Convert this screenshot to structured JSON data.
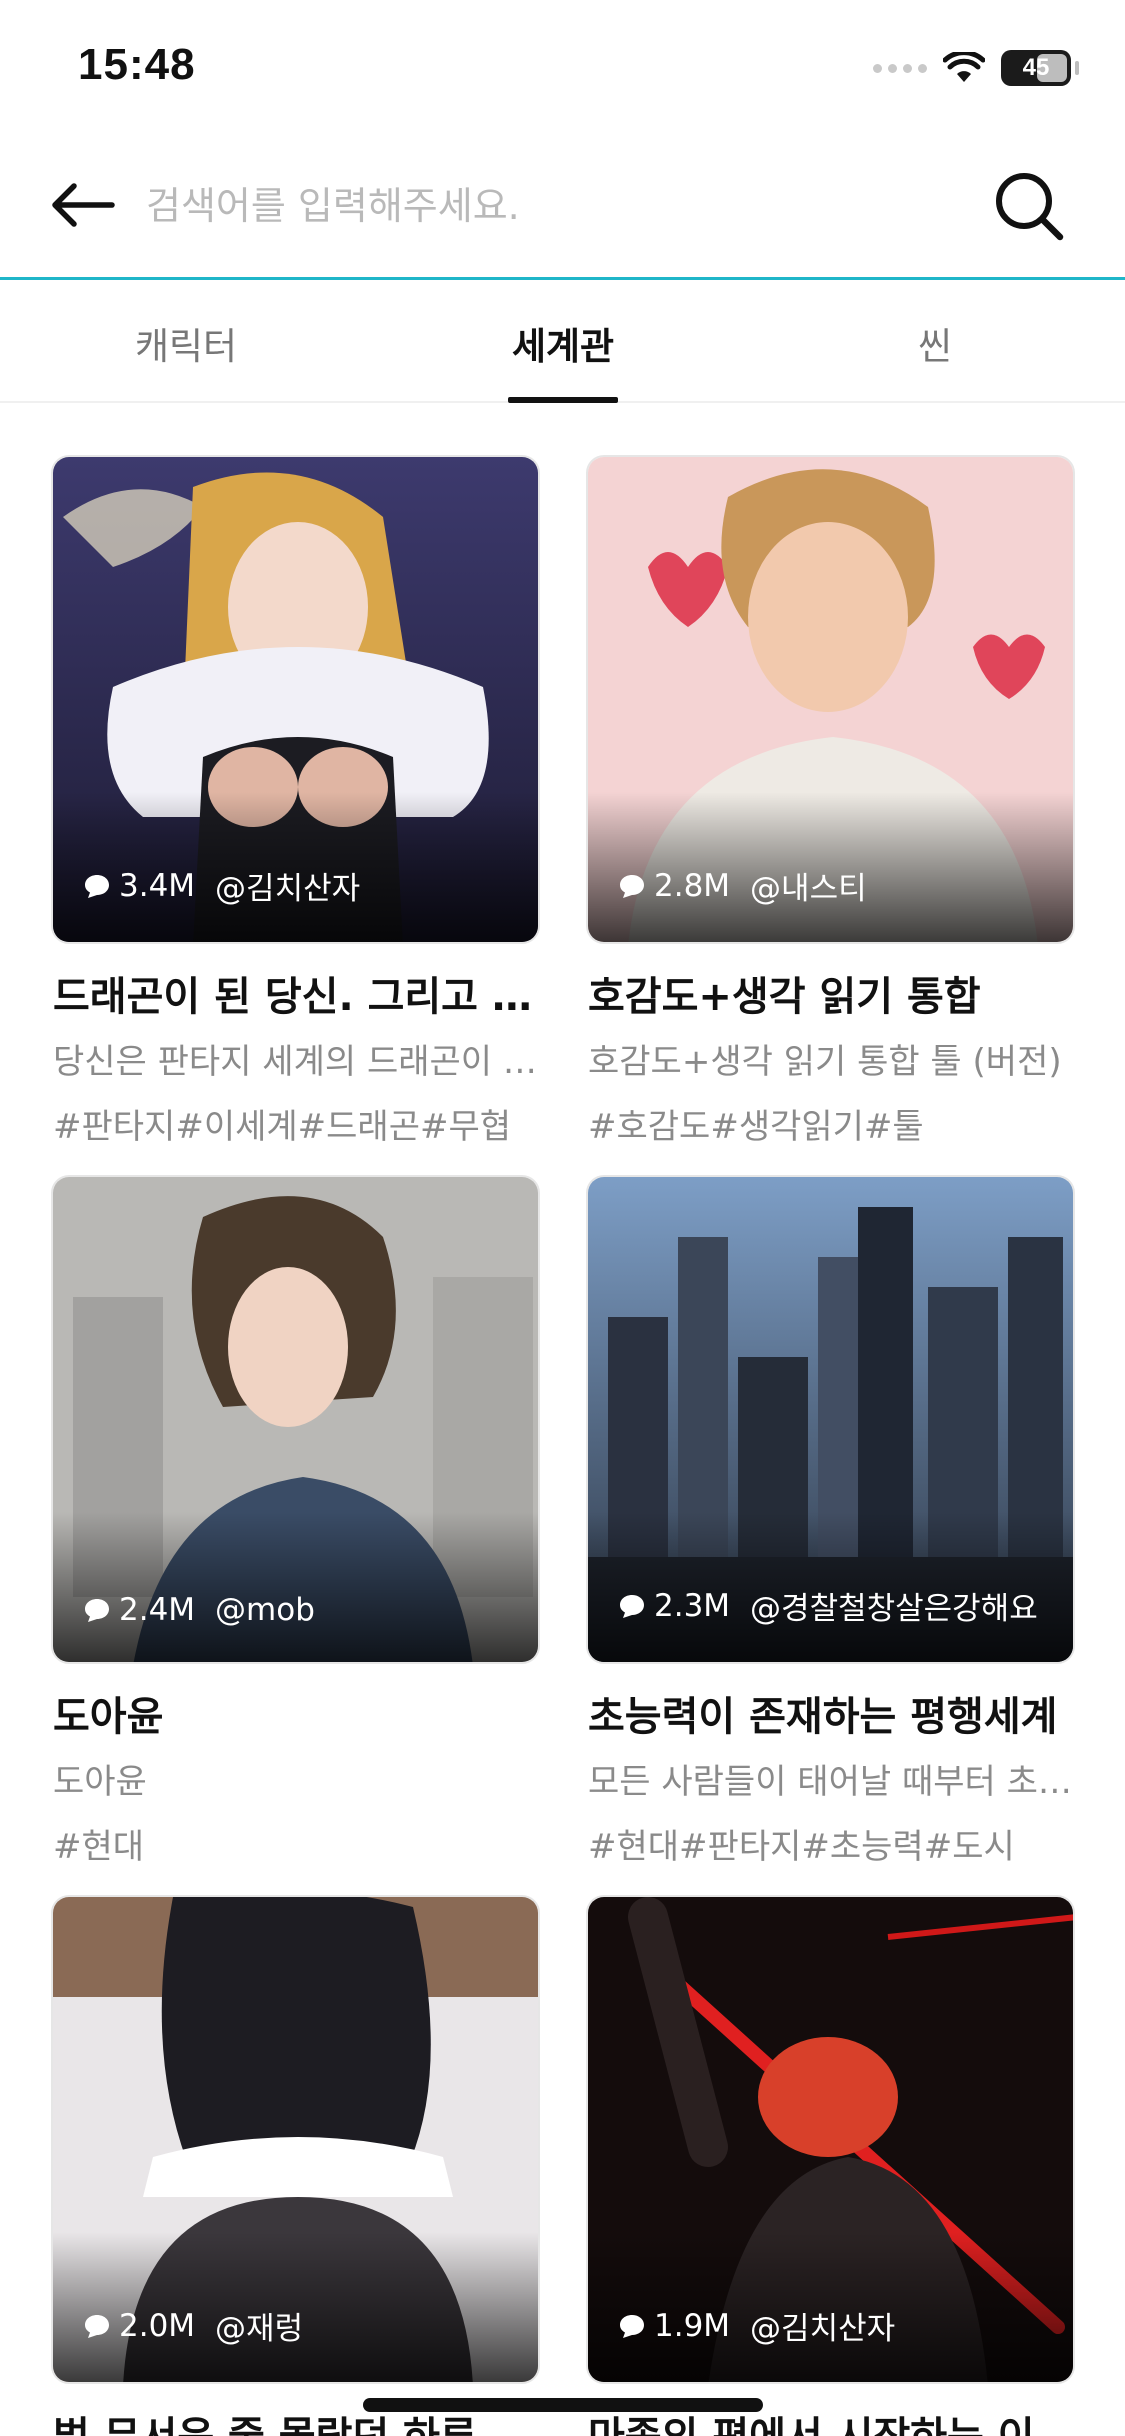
{
  "status_bar": {
    "time": "15:48",
    "battery": "45"
  },
  "search": {
    "placeholder": "검색어를 입력해주세요."
  },
  "tabs": [
    {
      "label": "캐릭터",
      "active": false
    },
    {
      "label": "세계관",
      "active": true
    },
    {
      "label": "씬",
      "active": false
    }
  ],
  "cards": [
    {
      "chats": "3.4M",
      "author": "@김치산자",
      "title": "드래곤이 된 당신. 그리고 세계의 드래곤들",
      "description": "당신은 판타지 세계의 드래곤이 되었다",
      "tags": "#판타지#이세계#드래곤#무협"
    },
    {
      "chats": "2.8M",
      "author": "@내스티",
      "title": "호감도+생각 읽기 통합",
      "description": "호감도+생각 읽기 통합 툴 (버전)",
      "tags": "#호감도#생각읽기#툴"
    },
    {
      "chats": "2.4M",
      "author": "@mob",
      "title": "도아윤",
      "description": "도아윤",
      "tags": "#현대"
    },
    {
      "chats": "2.3M",
      "author": "@경찰철창살은강해요",
      "title": "초능력이 존재하는 평행세계",
      "description": "모든 사람들이 태어날 때부터 초능력을",
      "tags": "#현대#판타지#초능력#도시"
    },
    {
      "chats": "2.0M",
      "author": "@재렁",
      "title": "벌 무서운 줄 몰랐던 하루의 끝",
      "description": "",
      "tags": ""
    },
    {
      "chats": "1.9M",
      "author": "@김치산자",
      "title": "마족의 편에서 시작하는 이야기",
      "description": "",
      "tags": ""
    }
  ],
  "colors": {
    "accent": "#1fb6c9",
    "text": "#111111",
    "muted": "#8a8a8a"
  }
}
